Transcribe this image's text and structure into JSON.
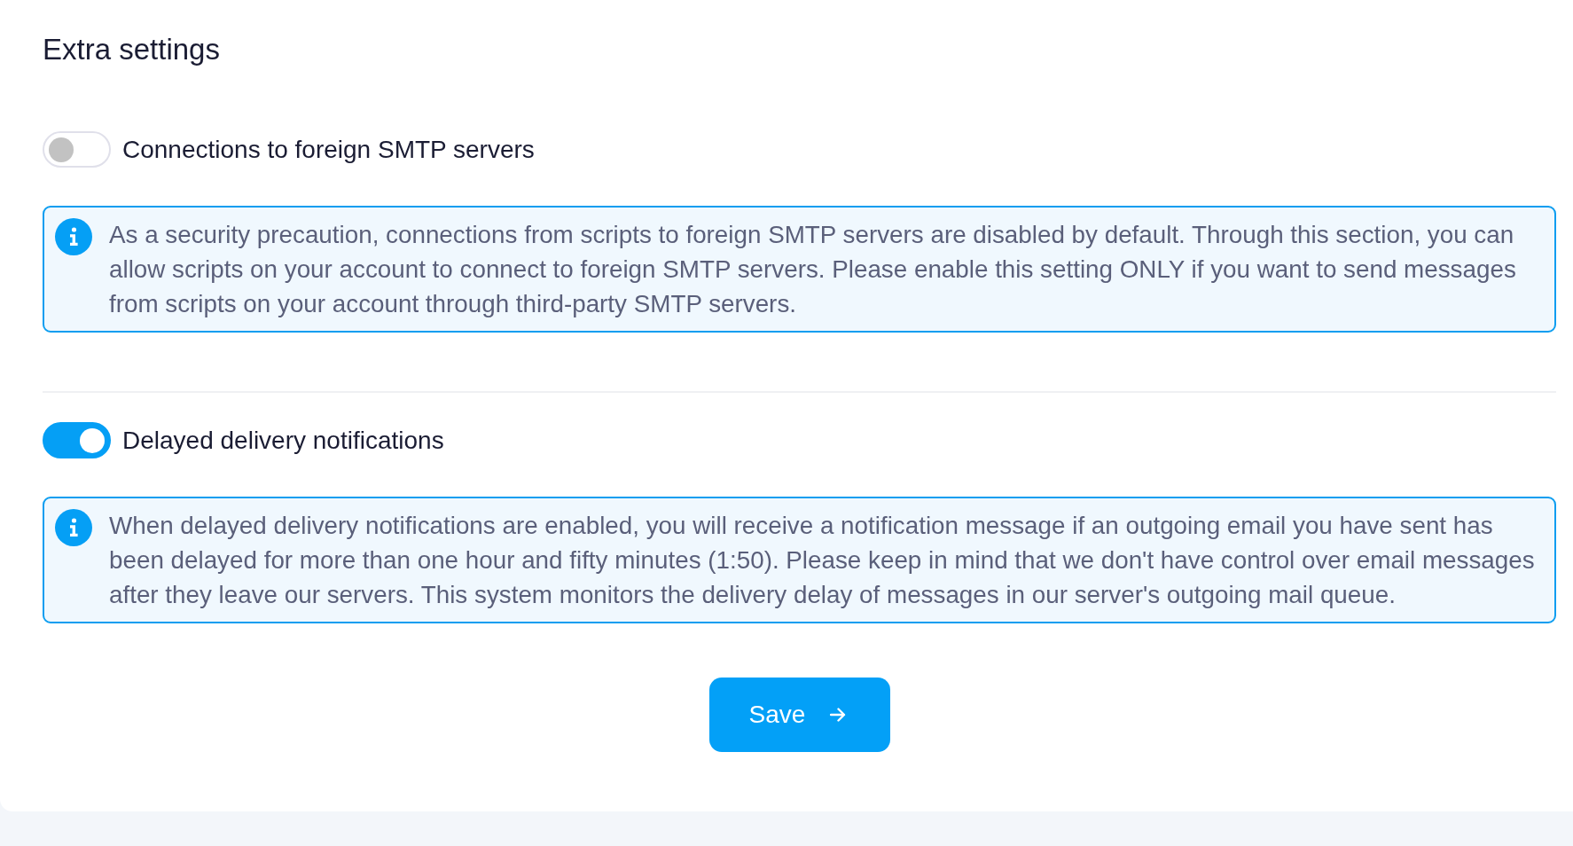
{
  "title": "Extra settings",
  "settings": [
    {
      "label": "Connections to foreign SMTP servers",
      "on": false,
      "info": "As a security precaution, connections from scripts to foreign SMTP servers are disabled by default. Through this section, you can allow scripts on your account to connect to foreign SMTP servers. Please enable this setting ONLY if you want to send messages from scripts on your account through third-party SMTP servers."
    },
    {
      "label": "Delayed delivery notifications",
      "on": true,
      "info": "When delayed delivery notifications are enabled, you will receive a notification message if an outgoing email you have sent has been delayed for more than one hour and fifty minutes (1:50). Please keep in mind that we don't have control over email messages after they leave our servers. This system monitors the delivery delay of messages in our server's outgoing mail queue."
    }
  ],
  "save_button": {
    "label": "Save"
  }
}
